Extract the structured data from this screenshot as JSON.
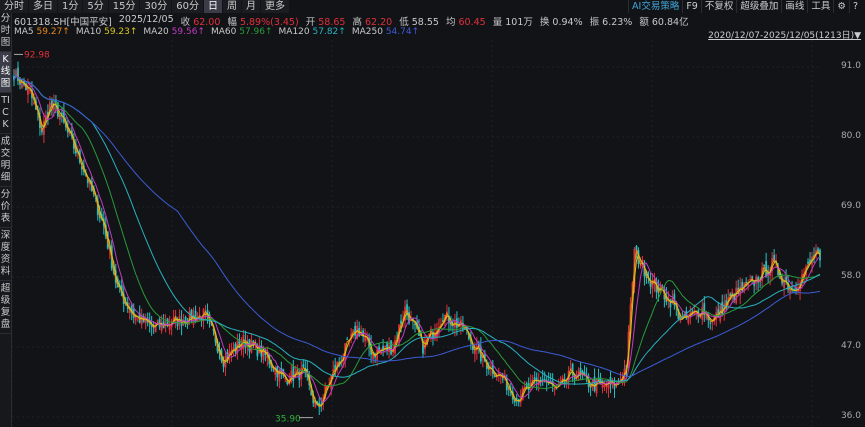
{
  "tabs": [
    "分时",
    "多日",
    "1分",
    "5分",
    "15分",
    "30分",
    "60分",
    "日",
    "周",
    "月",
    "更多"
  ],
  "active_tab": "日",
  "tools": [
    "AI交易策略",
    "F9",
    "不复权",
    "超级叠加",
    "画线",
    "工具"
  ],
  "tool_icons": [
    "gear-icon",
    "help-icon"
  ],
  "info": {
    "code": "601318.SH[中国平安]",
    "date": "2025/12/05",
    "close_label": "收",
    "close": "62.00",
    "chg_label": "幅",
    "chg": "5.89%(3.45)",
    "open_label": "开",
    "open": "58.65",
    "high_label": "高",
    "high": "62.20",
    "low_label": "低",
    "low": "58.55",
    "avg_label": "均",
    "avg": "60.45",
    "vol_label": "量",
    "vol": "101万",
    "turn_label": "换",
    "turn": "0.94%",
    "amp_label": "振",
    "amp": "6.23%",
    "amt_label": "额",
    "amt": "60.84亿"
  },
  "ma": [
    {
      "name": "MA5",
      "value": "59.27↑",
      "color": "#e88a1a"
    },
    {
      "name": "MA10",
      "value": "59.23↑",
      "color": "#d6c51e"
    },
    {
      "name": "MA20",
      "value": "59.56↑",
      "color": "#c23bc2"
    },
    {
      "name": "MA60",
      "value": "57.96↑",
      "color": "#2a9a3a"
    },
    {
      "name": "MA120",
      "value": "57.82↑",
      "color": "#27b3c0"
    },
    {
      "name": "MA250",
      "value": "54.74↑",
      "color": "#3d5cd6"
    }
  ],
  "range": "2020/12/07-2025/12/05(1213日)▼",
  "sidebar": [
    "分时图",
    "K线图",
    "TICK",
    "成交明细",
    "分价表",
    "深度资料",
    "超级复盘"
  ],
  "sidebar_active": "K线图",
  "colors": {
    "up": "#e0303a",
    "down": "#27c0c0"
  },
  "chart_data": {
    "type": "candlestick",
    "y_ticks": [
      "91.0",
      "80.0",
      "69.0",
      "58.0",
      "47.0",
      "36.0"
    ],
    "ylim": [
      36,
      91
    ],
    "max_label": "92.98",
    "min_label": "35.90",
    "close_anchors": [
      [
        0,
        90
      ],
      [
        8,
        87
      ],
      [
        14,
        81
      ],
      [
        18,
        85
      ],
      [
        22,
        84
      ],
      [
        35,
        75
      ],
      [
        45,
        66
      ],
      [
        52,
        56
      ],
      [
        60,
        52
      ],
      [
        70,
        50
      ],
      [
        80,
        51
      ],
      [
        95,
        52
      ],
      [
        100,
        49
      ],
      [
        105,
        45
      ],
      [
        115,
        48
      ],
      [
        125,
        46
      ],
      [
        135,
        42
      ],
      [
        145,
        43
      ],
      [
        152,
        37
      ],
      [
        160,
        43
      ],
      [
        172,
        50
      ],
      [
        180,
        46
      ],
      [
        190,
        47
      ],
      [
        196,
        53
      ],
      [
        205,
        47
      ],
      [
        215,
        52
      ],
      [
        225,
        50
      ],
      [
        235,
        45
      ],
      [
        245,
        42
      ],
      [
        252,
        39
      ],
      [
        265,
        42
      ],
      [
        272,
        40
      ],
      [
        280,
        43
      ],
      [
        290,
        41
      ],
      [
        302,
        41
      ],
      [
        307,
        44
      ],
      [
        311,
        62
      ],
      [
        320,
        57
      ],
      [
        330,
        54
      ],
      [
        335,
        51
      ],
      [
        345,
        53
      ],
      [
        350,
        51
      ],
      [
        360,
        55
      ],
      [
        370,
        57
      ],
      [
        380,
        60
      ],
      [
        390,
        56
      ],
      [
        397,
        59
      ],
      [
        402,
        62
      ],
      [
        404,
        60
      ]
    ]
  }
}
